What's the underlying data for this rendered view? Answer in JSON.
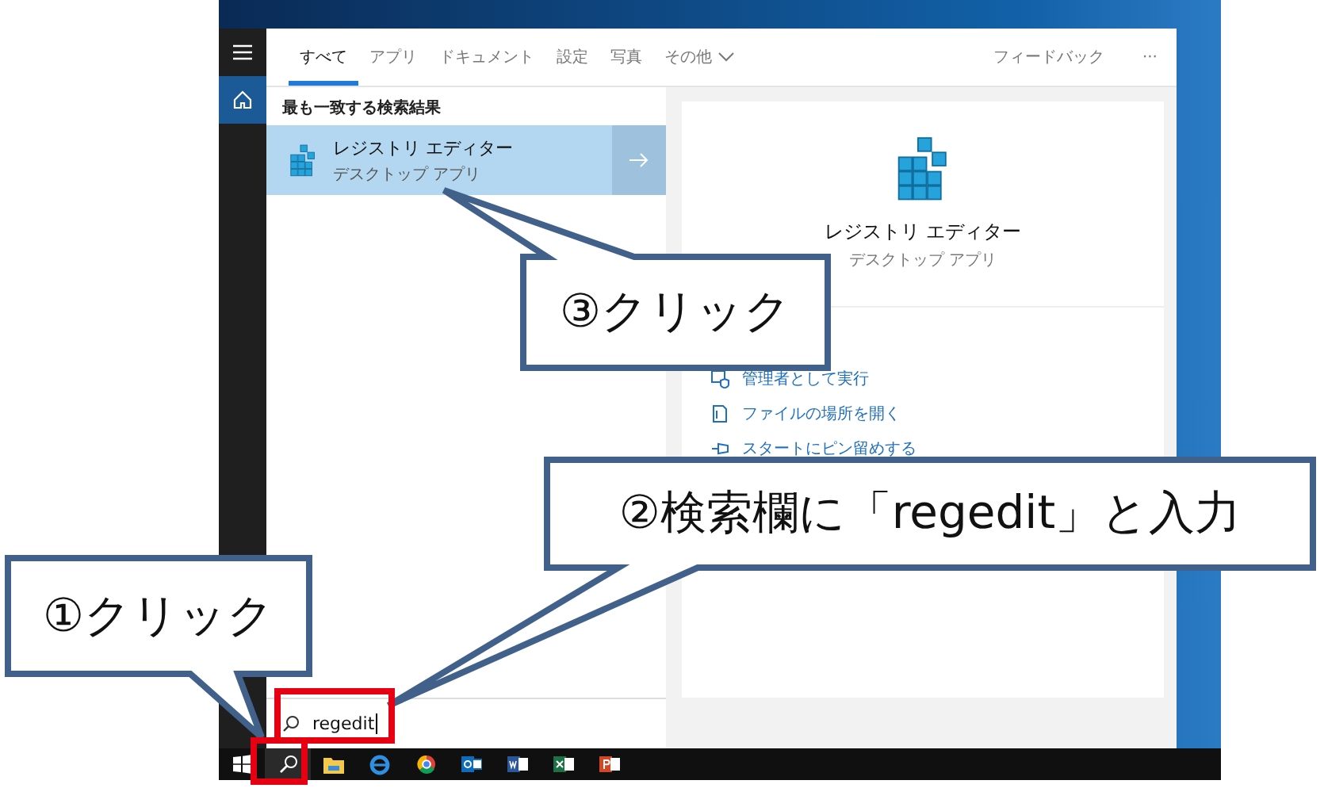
{
  "rail": [
    {
      "kind": "menu",
      "selected": false
    },
    {
      "kind": "home",
      "selected": true
    }
  ],
  "tabs": [
    {
      "label": "すべて",
      "selected": true
    },
    {
      "label": "アプリ",
      "selected": false
    },
    {
      "label": "ドキュメント",
      "selected": false
    },
    {
      "label": "設定",
      "selected": false
    },
    {
      "label": "写真",
      "selected": false
    },
    {
      "label": "その他",
      "selected": false,
      "dropdown": true
    }
  ],
  "header_actions": {
    "feedback": "フィードバック",
    "more": "···"
  },
  "best_match": {
    "heading": "最も一致する検索結果",
    "title": "レジストリ エディター",
    "subtitle": "デスクトップ アプリ",
    "selected": true
  },
  "preview": {
    "title": "レジストリ エディター",
    "subtitle": "デスクトップ アプリ"
  },
  "actions": [
    {
      "kind": "admin",
      "label": "管理者として実行"
    },
    {
      "kind": "folder",
      "label": "ファイルの場所を開く"
    },
    {
      "kind": "pin",
      "label": "スタートにピン留めする"
    }
  ],
  "search": {
    "value": "regedit"
  },
  "annotations": [
    {
      "text": "③クリック"
    },
    {
      "text": "②検索欄に「regedit」と入力"
    },
    {
      "text": "①クリック"
    }
  ]
}
